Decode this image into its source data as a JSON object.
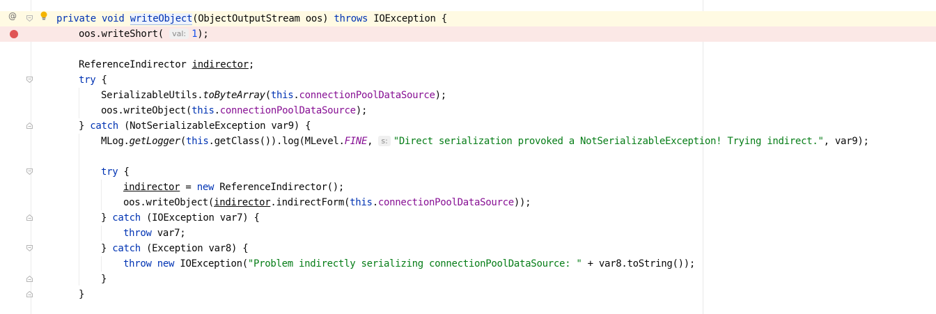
{
  "editor": {
    "gutter": {
      "override_icon": "@",
      "breakpoint_icon": "breakpoint-dot"
    },
    "hints": {
      "val": "val:",
      "s": "s:"
    },
    "lines": [
      {
        "id": "l1",
        "tokens": [
          "private",
          "void",
          "writeObject",
          "(ObjectOutputStream oos) ",
          "throws",
          " IOException {"
        ]
      },
      {
        "id": "l2",
        "tokens": [
          "oos.writeShort( ",
          "1",
          ");"
        ]
      },
      {
        "id": "l3",
        "tokens": []
      },
      {
        "id": "l4",
        "tokens": [
          "ReferenceIndirector ",
          "indirector",
          ";"
        ]
      },
      {
        "id": "l5",
        "tokens": [
          "try",
          " {"
        ]
      },
      {
        "id": "l6",
        "tokens": [
          "SerializableUtils.",
          "toByteArray",
          "(",
          "this",
          ".",
          "connectionPoolDataSource",
          ");"
        ]
      },
      {
        "id": "l7",
        "tokens": [
          "oos.writeObject(",
          "this",
          ".",
          "connectionPoolDataSource",
          ");"
        ]
      },
      {
        "id": "l8",
        "tokens": [
          "} ",
          "catch",
          " (NotSerializableException var9) {"
        ]
      },
      {
        "id": "l9",
        "tokens": [
          "MLog.",
          "getLogger",
          "(",
          "this",
          ".getClass()).log(MLevel.",
          "FINE",
          ", ",
          "\"Direct serialization provoked a NotSerializableException! Trying indirect.\"",
          ", var9);"
        ]
      },
      {
        "id": "l10",
        "tokens": []
      },
      {
        "id": "l11",
        "tokens": [
          "try",
          " {"
        ]
      },
      {
        "id": "l12",
        "tokens": [
          "indirector",
          " = ",
          "new",
          " ReferenceIndirector();"
        ]
      },
      {
        "id": "l13",
        "tokens": [
          "oos.writeObject(",
          "indirector",
          ".indirectForm(",
          "this",
          ".",
          "connectionPoolDataSource",
          "));"
        ]
      },
      {
        "id": "l14",
        "tokens": [
          "} ",
          "catch",
          " (IOException var7) {"
        ]
      },
      {
        "id": "l15",
        "tokens": [
          "throw",
          " var7;"
        ]
      },
      {
        "id": "l16",
        "tokens": [
          "} ",
          "catch",
          " (Exception var8) {"
        ]
      },
      {
        "id": "l17",
        "tokens": [
          "throw",
          " ",
          "new",
          " IOException(",
          "\"Problem indirectly serializing connectionPoolDataSource: \"",
          " + var8.toString());"
        ]
      },
      {
        "id": "l18",
        "tokens": [
          "}"
        ]
      },
      {
        "id": "l19",
        "tokens": [
          "}"
        ]
      }
    ]
  }
}
